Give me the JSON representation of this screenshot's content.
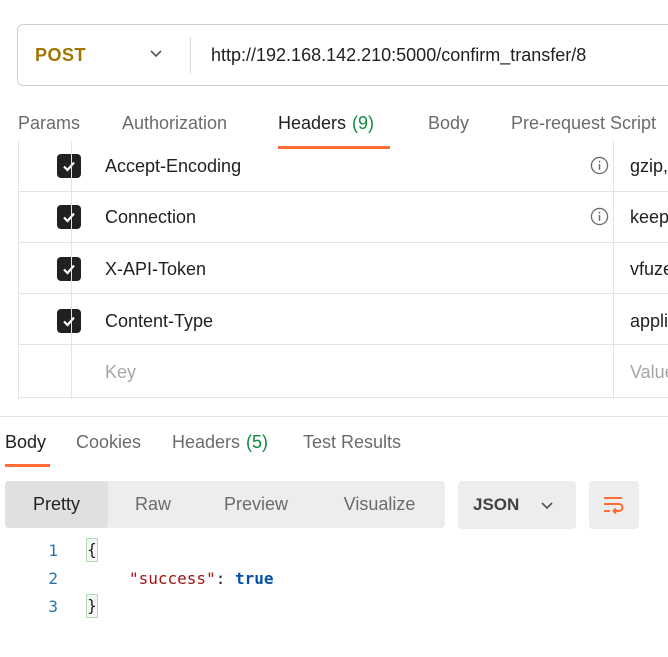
{
  "request": {
    "method": "POST",
    "url": "http://192.168.142.210:5000/confirm_transfer/8"
  },
  "request_tabs": [
    {
      "label": "Params"
    },
    {
      "label": "Authorization"
    },
    {
      "label": "Headers",
      "count": "(9)"
    },
    {
      "label": "Body"
    },
    {
      "label": "Pre-request Script"
    }
  ],
  "headers": [
    {
      "key": "Accept-Encoding",
      "value": "gzip,",
      "checked": true,
      "info": true
    },
    {
      "key": "Connection",
      "value": "keep",
      "checked": true,
      "info": true
    },
    {
      "key": "X-API-Token",
      "value": "vfuze",
      "checked": true,
      "info": false
    },
    {
      "key": "Content-Type",
      "value": "appli",
      "checked": true,
      "info": false
    }
  ],
  "new_header": {
    "key_placeholder": "Key",
    "value_placeholder": "Value"
  },
  "response_tabs": [
    {
      "label": "Body"
    },
    {
      "label": "Cookies"
    },
    {
      "label": "Headers",
      "count": "(5)"
    },
    {
      "label": "Test Results"
    }
  ],
  "view_modes": [
    "Pretty",
    "Raw",
    "Preview",
    "Visualize"
  ],
  "format": "JSON",
  "code": {
    "lines": [
      "1",
      "2",
      "3"
    ],
    "open_brace": "{",
    "close_brace": "}",
    "key": "\"success\"",
    "colon": ": ",
    "value": "true"
  },
  "colors": {
    "accent": "#ff6c37",
    "method": "#a17600",
    "count": "#0f8a3c"
  },
  "icons": [
    "chevron-down-icon",
    "checkbox-checked-icon",
    "info-icon",
    "wrap-lines-icon"
  ]
}
